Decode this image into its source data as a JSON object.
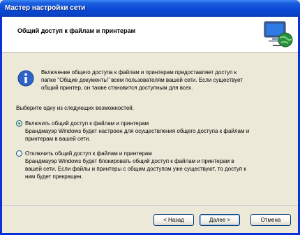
{
  "window": {
    "title": "Мастер настройки сети"
  },
  "header": {
    "title": "Общий доступ к файлам и принтерам",
    "icon": "network-computer-icon"
  },
  "info": {
    "icon": "info-icon",
    "line1": "Включение общего доступа к файлам и принтерам предоставляет доступ к",
    "line2": "папке \"Общие документы\" всем пользователям вашей сети. Если существует",
    "line3": "общий принтер, он также становится доступным для всех."
  },
  "prompt": "Выберите одну из следующих возможностей.",
  "options": [
    {
      "label": "Включить общий доступ к файлам и принтерам",
      "selected": true,
      "desc1": "Брандмауэр Windows будет настроен для осуществления общего доступа к файлам и",
      "desc2": "принтерам в вашей сети.",
      "desc3": ""
    },
    {
      "label": "Отключить общий доступ к файлам и принтерам",
      "selected": false,
      "desc1": "Брандмауэр Windows будет блокировать общий доступ к файлам и принтерам в",
      "desc2": "вашей сети. Если файлы и принтеры с общим доступом уже существуют, то доступ к",
      "desc3": "ним будет прекращен."
    }
  ],
  "buttons": {
    "back": "< Назад",
    "next": "Далее >",
    "cancel": "Отмена"
  },
  "colors": {
    "titlebar": "#0a49d6",
    "window_bg": "#ece9d8",
    "radio_dot": "#21a121"
  }
}
